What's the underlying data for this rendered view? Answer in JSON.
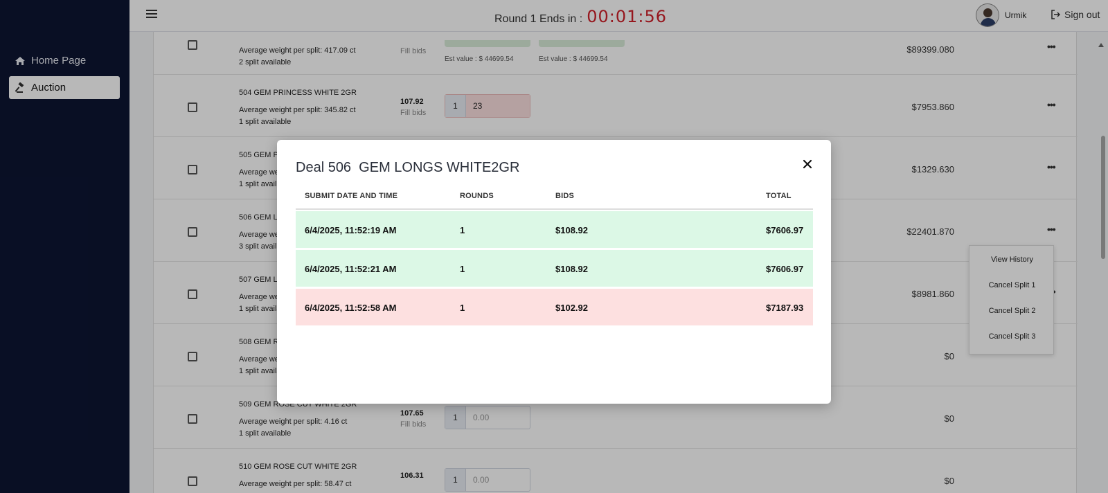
{
  "sidebar": {
    "items": [
      {
        "label": "Home Page",
        "icon": "home-icon"
      },
      {
        "label": "Auction",
        "icon": "gavel-icon",
        "active": true
      }
    ]
  },
  "header": {
    "round_label": "Round 1 Ends in :",
    "timer": "00:01:56",
    "user_name": "Urmik",
    "signout_label": "Sign out"
  },
  "table": {
    "rows": [
      {
        "name": "",
        "avg": "Average weight per split: 417.09 ct",
        "splits": "2 split available",
        "price": "",
        "fill": "Fill bids",
        "est1": "Est value :  $ 44699.54",
        "est2": "Est value :  $ 44699.54",
        "amount": "$89399.080"
      },
      {
        "name": "504 GEM PRINCESS WHITE 2GR",
        "avg": "Average weight per split: 345.82 ct",
        "splits": "1 split available",
        "price": "107.92",
        "fill": "Fill bids",
        "qty": "1",
        "bid": "23",
        "amount": "$7953.860"
      },
      {
        "name": "505 GEM P",
        "avg": "Average we",
        "splits": "1 split avail",
        "amount": "$1329.630"
      },
      {
        "name": "506 GEM L",
        "avg": "Average weig",
        "splits": "3 split avail",
        "amount": "$22401.870"
      },
      {
        "name": "507 GEM L",
        "avg": "Average wei",
        "splits": "1 split availa",
        "amount": "$8981.860"
      },
      {
        "name": "508 GEM R",
        "avg": "Average wei",
        "splits": "1 split availa",
        "amount": "$0"
      },
      {
        "name": "509 GEM ROSE CUT WHITE 2GR",
        "avg": "Average weight per split: 4.16 ct",
        "splits": "1 split available",
        "price": "107.65",
        "fill": "Fill bids",
        "qty": "1",
        "bid": "0.00",
        "amount": "$0"
      },
      {
        "name": "510 GEM ROSE CUT WHITE 2GR",
        "avg": "Average weight per split: 58.47 ct",
        "splits": "",
        "price": "106.31",
        "fill": "",
        "qty": "1",
        "bid": "0.00",
        "amount": "$0"
      }
    ]
  },
  "context_menu": {
    "items": [
      "View History",
      "Cancel Split 1",
      "Cancel Split 2",
      "Cancel Split 3"
    ]
  },
  "modal": {
    "title": "Deal 506  GEM LONGS WHITE2GR",
    "columns": [
      "SUBMIT DATE AND TIME",
      "ROUNDS",
      "BIDS",
      "TOTAL"
    ],
    "rows": [
      {
        "date": "6/4/2025, 11:52:19 AM",
        "round": "1",
        "bid": "$108.92",
        "total": "$7606.97",
        "status": "green"
      },
      {
        "date": "6/4/2025, 11:52:21 AM",
        "round": "1",
        "bid": "$108.92",
        "total": "$7606.97",
        "status": "green"
      },
      {
        "date": "6/4/2025, 11:52:58 AM",
        "round": "1",
        "bid": "$102.92",
        "total": "$7187.93",
        "status": "red"
      }
    ]
  },
  "colors": {
    "sidebar_bg": "#0d1533",
    "timer": "#d0202a",
    "row_green": "#dcf8e6",
    "row_red": "#fde0e0"
  }
}
